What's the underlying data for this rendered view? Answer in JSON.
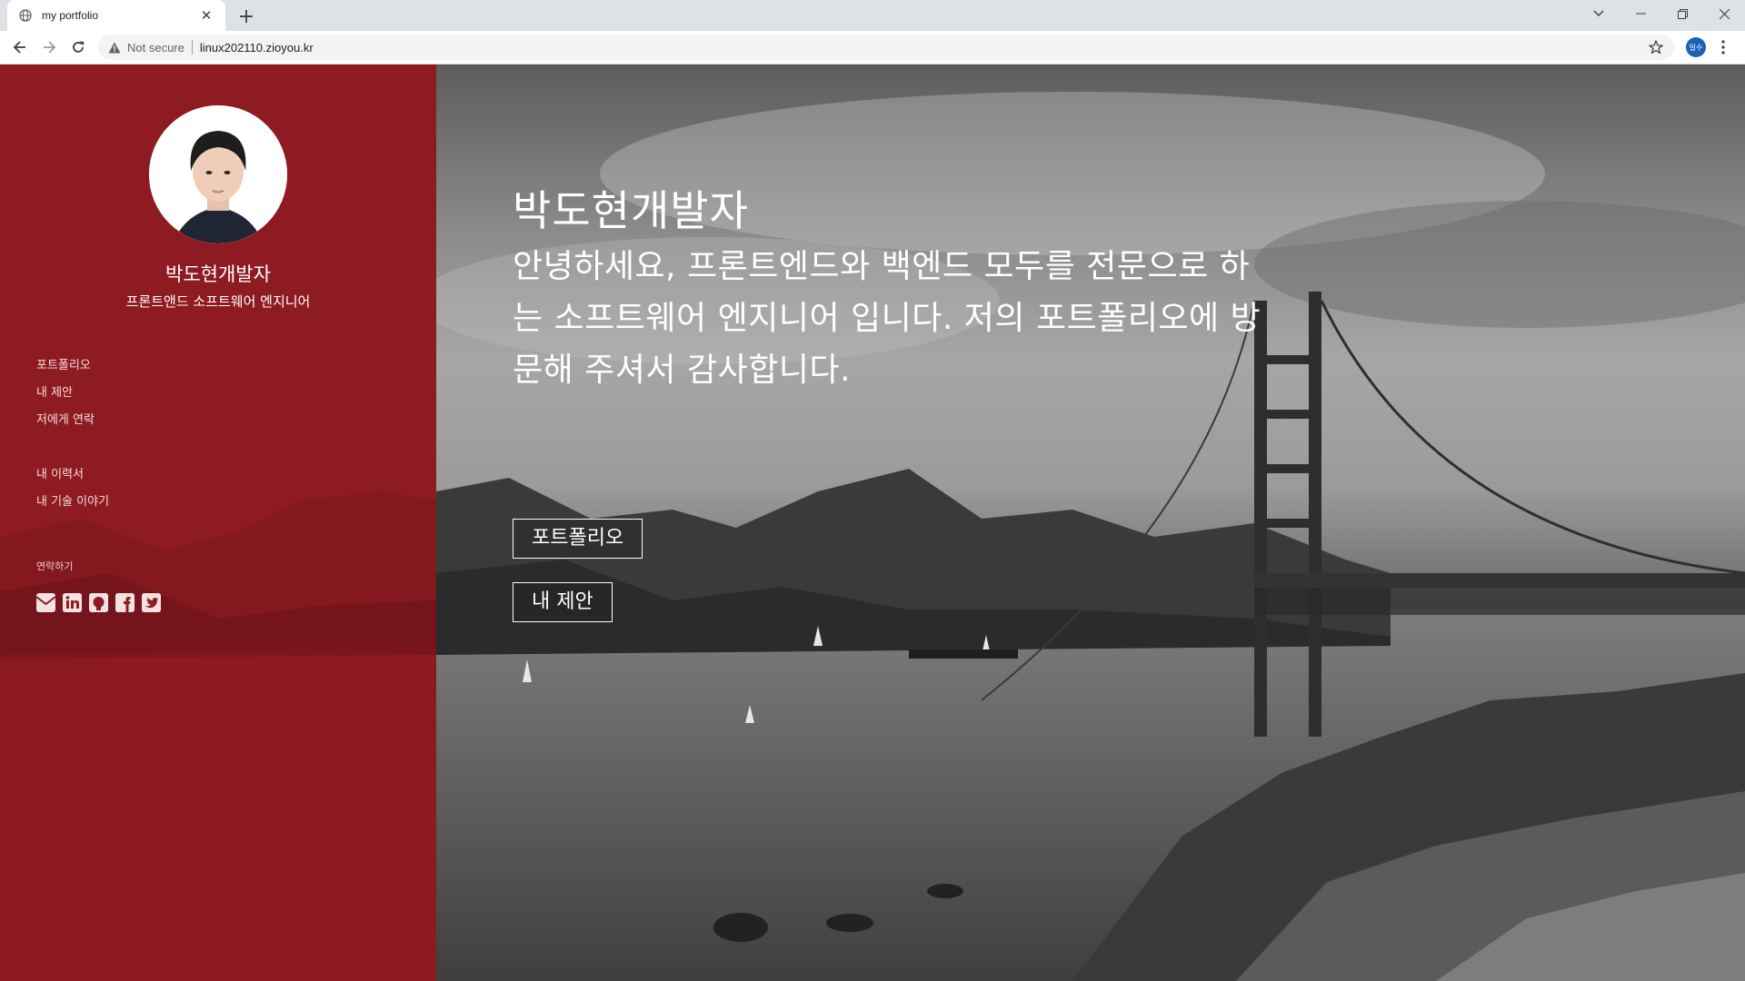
{
  "browser": {
    "tab_title": "my portfolio",
    "tab_close": "✕",
    "new_tab": "+",
    "not_secure": "Not secure",
    "url": "linux202110.zioyou.kr",
    "profile_label": "일수"
  },
  "sidebar": {
    "name": "박도현개발자",
    "role": "프론트앤드 소프트웨어 엔지니어",
    "nav_primary": [
      "포트폴리오",
      "내 제안",
      "저에게 연락"
    ],
    "nav_secondary": [
      "내 이력서",
      "내 기술 이야기"
    ],
    "contact_heading": "연락하기",
    "social_icons": [
      "envelope-icon",
      "linkedin-icon",
      "github-icon",
      "facebook-icon",
      "twitter-icon"
    ],
    "accent": "#8f1b22"
  },
  "hero": {
    "title": "박도현개발자",
    "intro": "안녕하세요, 프론트엔드와 백엔드 모두를 전문으로 하는 소프트웨어 엔지니어 입니다. 저의 포트폴리오에 방문해 주셔서 감사합니다.",
    "buttons": [
      "포트폴리오",
      "내 제안"
    ]
  }
}
